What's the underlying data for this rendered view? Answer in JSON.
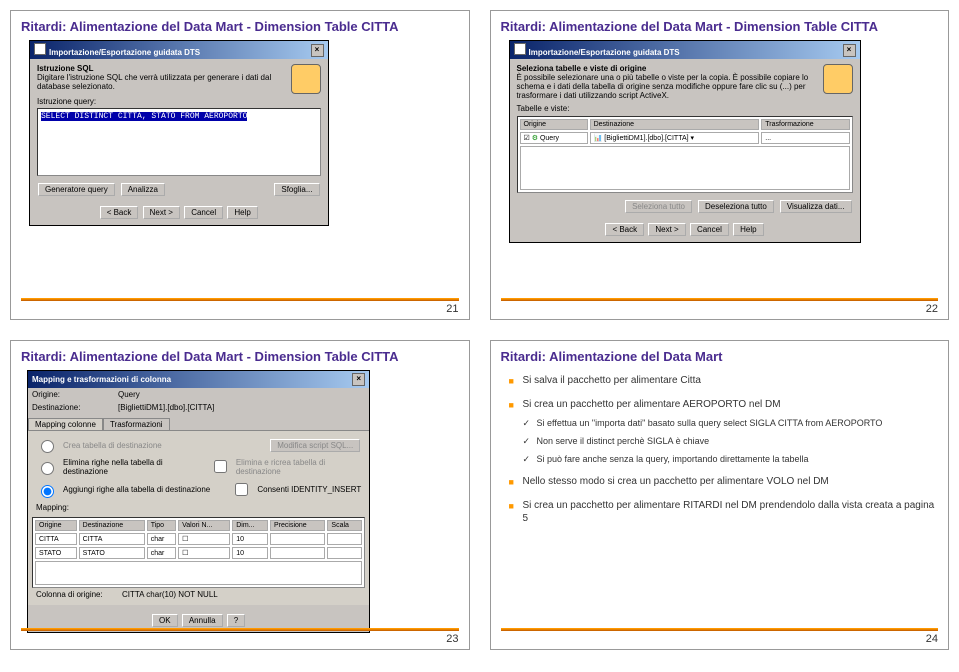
{
  "slides": {
    "s1": {
      "title": "Ritardi: Alimentazione del Data Mart - Dimension Table CITTA",
      "page": "21",
      "win_title": "Importazione/Esportazione guidata DTS",
      "h1": "Istruzione SQL",
      "h1sub": "Digitare l'istruzione SQL che verrà utilizzata per generare i dati dal database selezionato.",
      "lbl_query": "Istruzione query:",
      "sql": "SELECT DISTINCT CITTA, STATO FROM AEROPORTO",
      "btn_gen": "Generatore query",
      "btn_anal": "Analizza",
      "btn_sfog": "Sfoglia...",
      "btn_back": "< Back",
      "btn_next": "Next >",
      "btn_cancel": "Cancel",
      "btn_help": "Help"
    },
    "s2": {
      "title": "Ritardi: Alimentazione del Data Mart - Dimension Table CITTA",
      "page": "22",
      "win_title": "Importazione/Esportazione guidata DTS",
      "h1": "Seleziona tabelle e viste di origine",
      "h1sub": "È possibile selezionare una o più tabelle o viste per la copia. È possibile copiare lo schema e i dati della tabella di origine senza modifiche oppure fare clic su (...) per trasformare i dati utilizzando script ActiveX.",
      "lbl_tv": "Tabelle e viste:",
      "col_orig": "Origine",
      "col_dest": "Destinazione",
      "col_trasf": "Trasformazione",
      "row_orig": "Query",
      "row_dest": "[BigliettiDM1].[dbo].[CITTA]",
      "row_trasf": "...",
      "btn_sel": "Seleziona tutto",
      "btn_desel": "Deseleziona tutto",
      "btn_vis": "Visualizza dati...",
      "btn_back": "< Back",
      "btn_next": "Next >",
      "btn_cancel": "Cancel",
      "btn_help": "Help"
    },
    "s3": {
      "title": "Ritardi: Alimentazione del Data Mart - Dimension Table CITTA",
      "page": "23",
      "win_title": "Mapping e trasformazioni di colonna",
      "lbl_orig": "Origine:",
      "val_orig": "Query",
      "lbl_dest": "Destinazione:",
      "val_dest": "[BigliettiDM1].[dbo].[CITTA]",
      "tab1": "Mapping colonne",
      "tab2": "Trasformazioni",
      "opt1": "Crea tabella di destinazione",
      "opt1b": "Modifica script SQL...",
      "opt2": "Elimina righe nella tabella di destinazione",
      "opt2b": "Elimina e ricrea tabella di destinazione",
      "opt3": "Aggiungi righe alla tabella di destinazione",
      "opt3b": "Consenti IDENTITY_INSERT",
      "lbl_map": "Mapping:",
      "mcol1": "Origine",
      "mcol2": "Destinazione",
      "mcol3": "Tipo",
      "mcol4": "Valori N...",
      "mcol5": "Dim...",
      "mcol6": "Precisione",
      "mcol7": "Scala",
      "r1c1": "CITTA",
      "r1c2": "CITTA",
      "r1c3": "char",
      "r1c5": "10",
      "r2c1": "STATO",
      "r2c2": "STATO",
      "r2c3": "char",
      "r2c5": "10",
      "lbl_colorig": "Colonna di origine:",
      "val_colorig": "CITTA char(10) NOT NULL",
      "btn_ok": "OK",
      "btn_ann": "Annulla",
      "btn_q": "?"
    },
    "s4": {
      "title": "Ritardi: Alimentazione del Data Mart",
      "page": "24",
      "b1": "Si salva il pacchetto per alimentare Citta",
      "b2": "Si crea un pacchetto per alimentare AEROPORTO nel DM",
      "b2s1": "Si effettua un \"importa dati\" basato sulla query select SIGLA CITTA from AEROPORTO",
      "b2s2": "Non serve il distinct perchè SIGLA è chiave",
      "b2s3": "Si può fare anche senza la query, importando direttamente la tabella",
      "b3": "Nello stesso modo si crea un pacchetto per alimentare VOLO nel DM",
      "b4": "Si crea un pacchetto per alimentare RITARDI nel DM prendendolo dalla vista creata a pagina 5"
    }
  }
}
